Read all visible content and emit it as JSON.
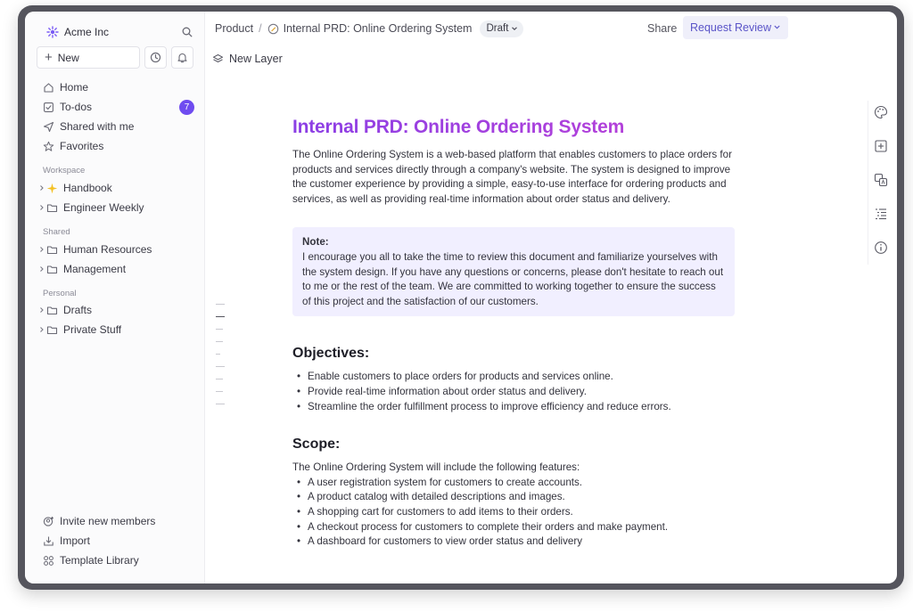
{
  "sidebar": {
    "workspace_name": "Acme Inc",
    "new_label": "New",
    "nav": [
      {
        "label": "Home",
        "icon": "home-icon"
      },
      {
        "label": "To-dos",
        "icon": "checkbox-icon",
        "badge": "7"
      },
      {
        "label": "Shared with me",
        "icon": "send-icon"
      },
      {
        "label": "Favorites",
        "icon": "star-icon"
      }
    ],
    "sections": {
      "workspace": {
        "label": "Workspace",
        "items": [
          {
            "label": "Handbook",
            "icon": "sparkle-emoji-icon"
          },
          {
            "label": "Engineer Weekly",
            "icon": "folder-icon"
          }
        ]
      },
      "shared": {
        "label": "Shared",
        "items": [
          {
            "label": "Human Resources",
            "icon": "folder-icon"
          },
          {
            "label": "Management",
            "icon": "folder-icon"
          }
        ]
      },
      "personal": {
        "label": "Personal",
        "items": [
          {
            "label": "Drafts",
            "icon": "folder-icon"
          },
          {
            "label": "Private Stuff",
            "icon": "folder-icon"
          }
        ]
      }
    },
    "bottom": [
      {
        "label": "Invite new members",
        "icon": "invite-icon"
      },
      {
        "label": "Import",
        "icon": "import-icon"
      },
      {
        "label": "Template Library",
        "icon": "template-icon"
      }
    ]
  },
  "header": {
    "breadcrumb_root": "Product",
    "breadcrumb_separator": "/",
    "breadcrumb_doc": "Internal PRD: Online Ordering System",
    "status": "Draft",
    "share_label": "Share",
    "review_label": "Request Review",
    "new_layer_label": "New Layer"
  },
  "document": {
    "title": "Internal PRD: Online Ordering System",
    "intro": "The Online Ordering System is a web-based platform that enables customers to place orders for products and services directly through a company's website. The system is designed to improve the customer experience by providing a simple, easy-to-use interface for ordering products and services, as well as providing real-time information about order status and delivery.",
    "note_title": "Note:",
    "note_body": "I encourage you all to take the time to review this document and familiarize yourselves with the system design. If you have any questions or concerns, please don't hesitate to reach out to me or the rest of the team. We are committed to working together to ensure the success of this project and the satisfaction of our customers.",
    "objectives_heading": "Objectives:",
    "objectives": [
      "Enable customers to place orders for products and services online.",
      "Provide real-time information about order status and delivery.",
      "Streamline the order fulfillment process to improve efficiency and reduce errors."
    ],
    "scope_heading": "Scope:",
    "scope_intro": "The Online Ordering System will include the following features:",
    "scope": [
      "A user registration system for customers to create accounts.",
      "A product catalog with detailed descriptions and images.",
      "A shopping cart for customers to add items to their orders.",
      "A checkout process for customers to complete their orders and make payment.",
      "A dashboard for customers to view order status and delivery"
    ]
  },
  "colors": {
    "accent": "#6f4cf0",
    "title_gradient_start": "#8b3fe5",
    "title_gradient_end": "#c041d6",
    "note_background": "#f1efff",
    "review_button_bg": "#efeffa"
  },
  "right_tools": [
    "palette-icon",
    "add-block-icon",
    "translate-icon",
    "outline-list-icon",
    "info-icon"
  ]
}
